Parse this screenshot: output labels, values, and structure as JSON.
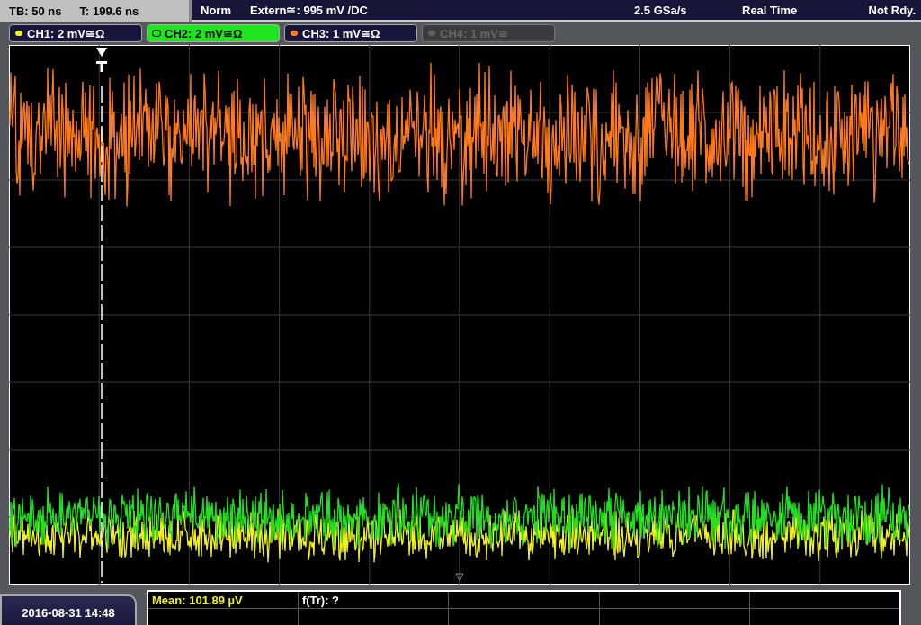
{
  "status_bar": {
    "timebase": "TB: 50 ns",
    "trigger_time": "T: 199.6 ns",
    "mode": "Norm",
    "trigger_source": "Extern≅: 995 mV /DC",
    "sample_rate": "2.5 GSa/s",
    "acquisition": "Real Time",
    "state": "Not Rdy."
  },
  "channels": [
    {
      "label": "CH1: 2 mV≅Ω",
      "color": "#f0f020",
      "selected": false,
      "enabled": true
    },
    {
      "label": "CH2: 2 mV≅Ω",
      "color": "#20e020",
      "selected": true,
      "enabled": true
    },
    {
      "label": "CH3: 1 mV≅Ω",
      "color": "#ff7a1a",
      "selected": false,
      "enabled": true
    },
    {
      "label": "CH4: 1 mV≅",
      "color": "#606060",
      "selected": false,
      "enabled": false
    }
  ],
  "date_time": "2016-08-31 14:48",
  "measurements": {
    "rows": [
      [
        "Mean: 101.89 µV",
        "f(Tr): ?",
        "",
        "",
        ""
      ],
      [
        "",
        "",
        "",
        "",
        ""
      ]
    ]
  }
}
